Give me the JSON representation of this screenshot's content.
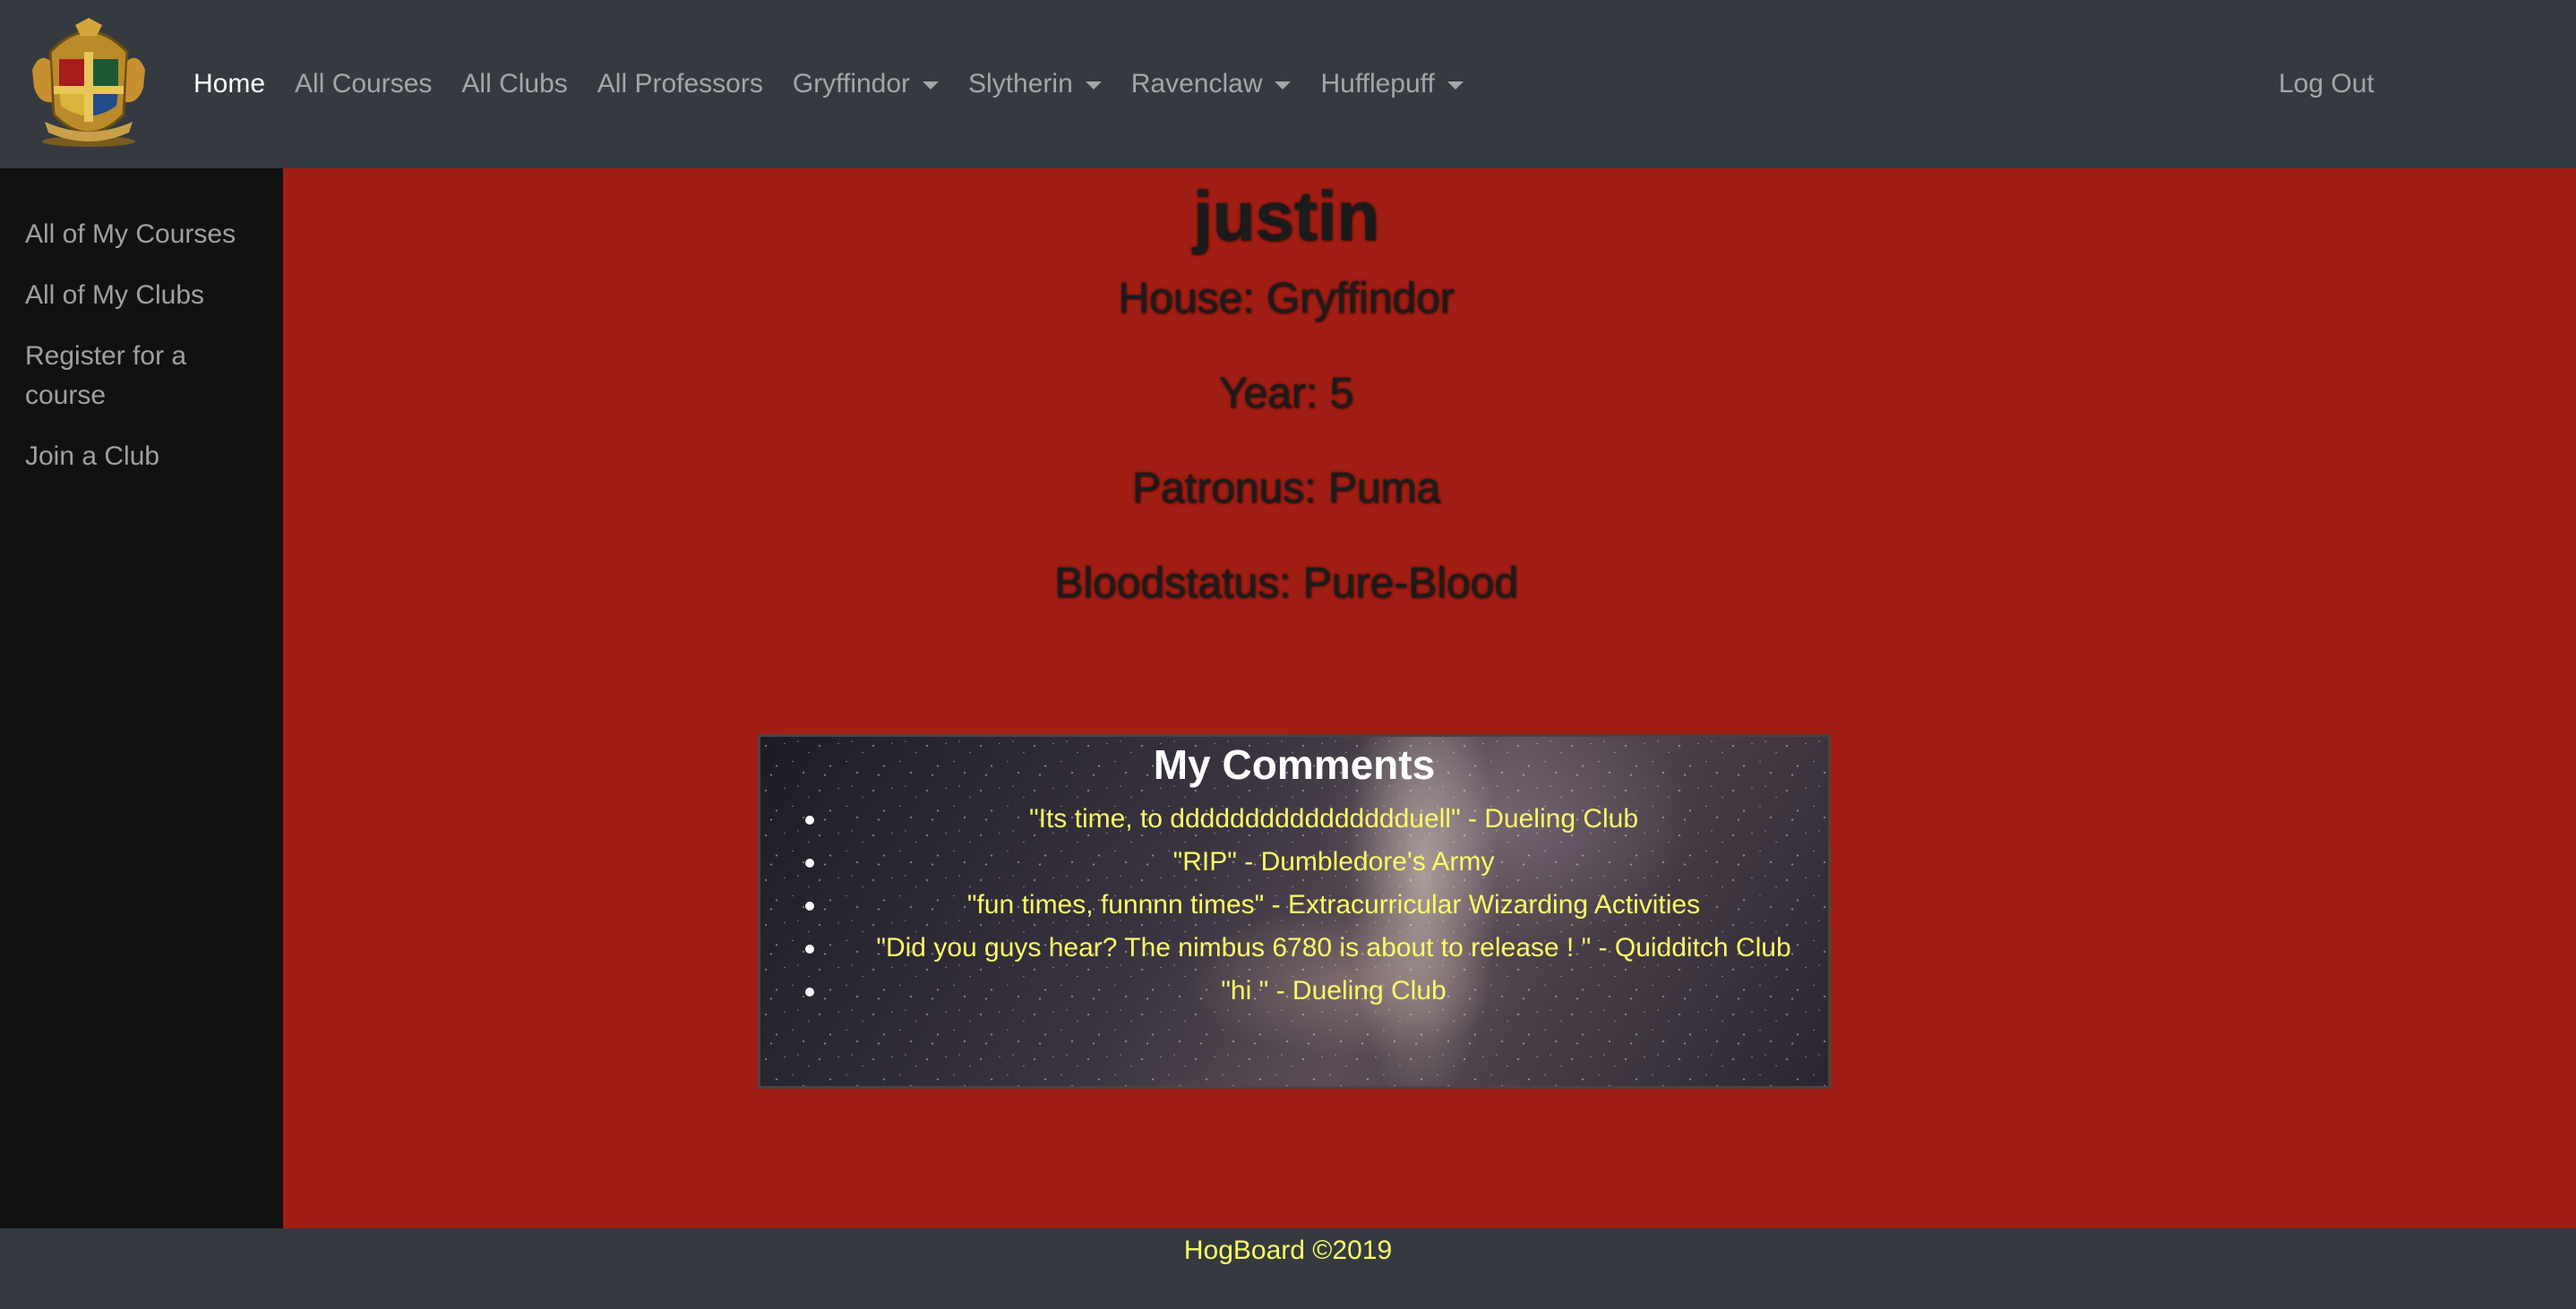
{
  "navbar": {
    "logo": "hogwarts-crest-icon",
    "links": [
      {
        "label": "Home",
        "active": true
      },
      {
        "label": "All Courses"
      },
      {
        "label": "All Clubs"
      },
      {
        "label": "All Professors"
      },
      {
        "label": "Gryffindor",
        "dropdown": true
      },
      {
        "label": "Slytherin",
        "dropdown": true
      },
      {
        "label": "Ravenclaw",
        "dropdown": true
      },
      {
        "label": "Hufflepuff",
        "dropdown": true
      }
    ],
    "logout": "Log Out"
  },
  "sidebar": {
    "items": [
      {
        "label": "All of My Courses"
      },
      {
        "label": "All of My Clubs"
      },
      {
        "label": "Register for a course"
      },
      {
        "label": "Join a Club"
      }
    ]
  },
  "profile": {
    "username": "justin",
    "house": "House: Gryffindor",
    "year": "Year: 5",
    "patronus": "Patronus: Puma",
    "bloodstatus": "Bloodstatus: Pure-Blood"
  },
  "comments": {
    "title": "My Comments",
    "items": [
      "\"Its time, to dddddddddddddddduell\" - Dueling Club",
      "\"RIP\" - Dumbledore's Army",
      "\"fun times, funnnn times\" - Extracurricular Wizarding Activities",
      "\"Did you guys hear? The nimbus 6780 is about to release !   \" - Quidditch Club",
      "\"hi \" - Dueling Club"
    ]
  },
  "footer": {
    "text": "HogBoard ©2019"
  },
  "colors": {
    "navbar_bg": "#343a40",
    "sidebar_bg": "#111111",
    "main_bg": "#a01e14",
    "comment_text": "#fefa66"
  }
}
